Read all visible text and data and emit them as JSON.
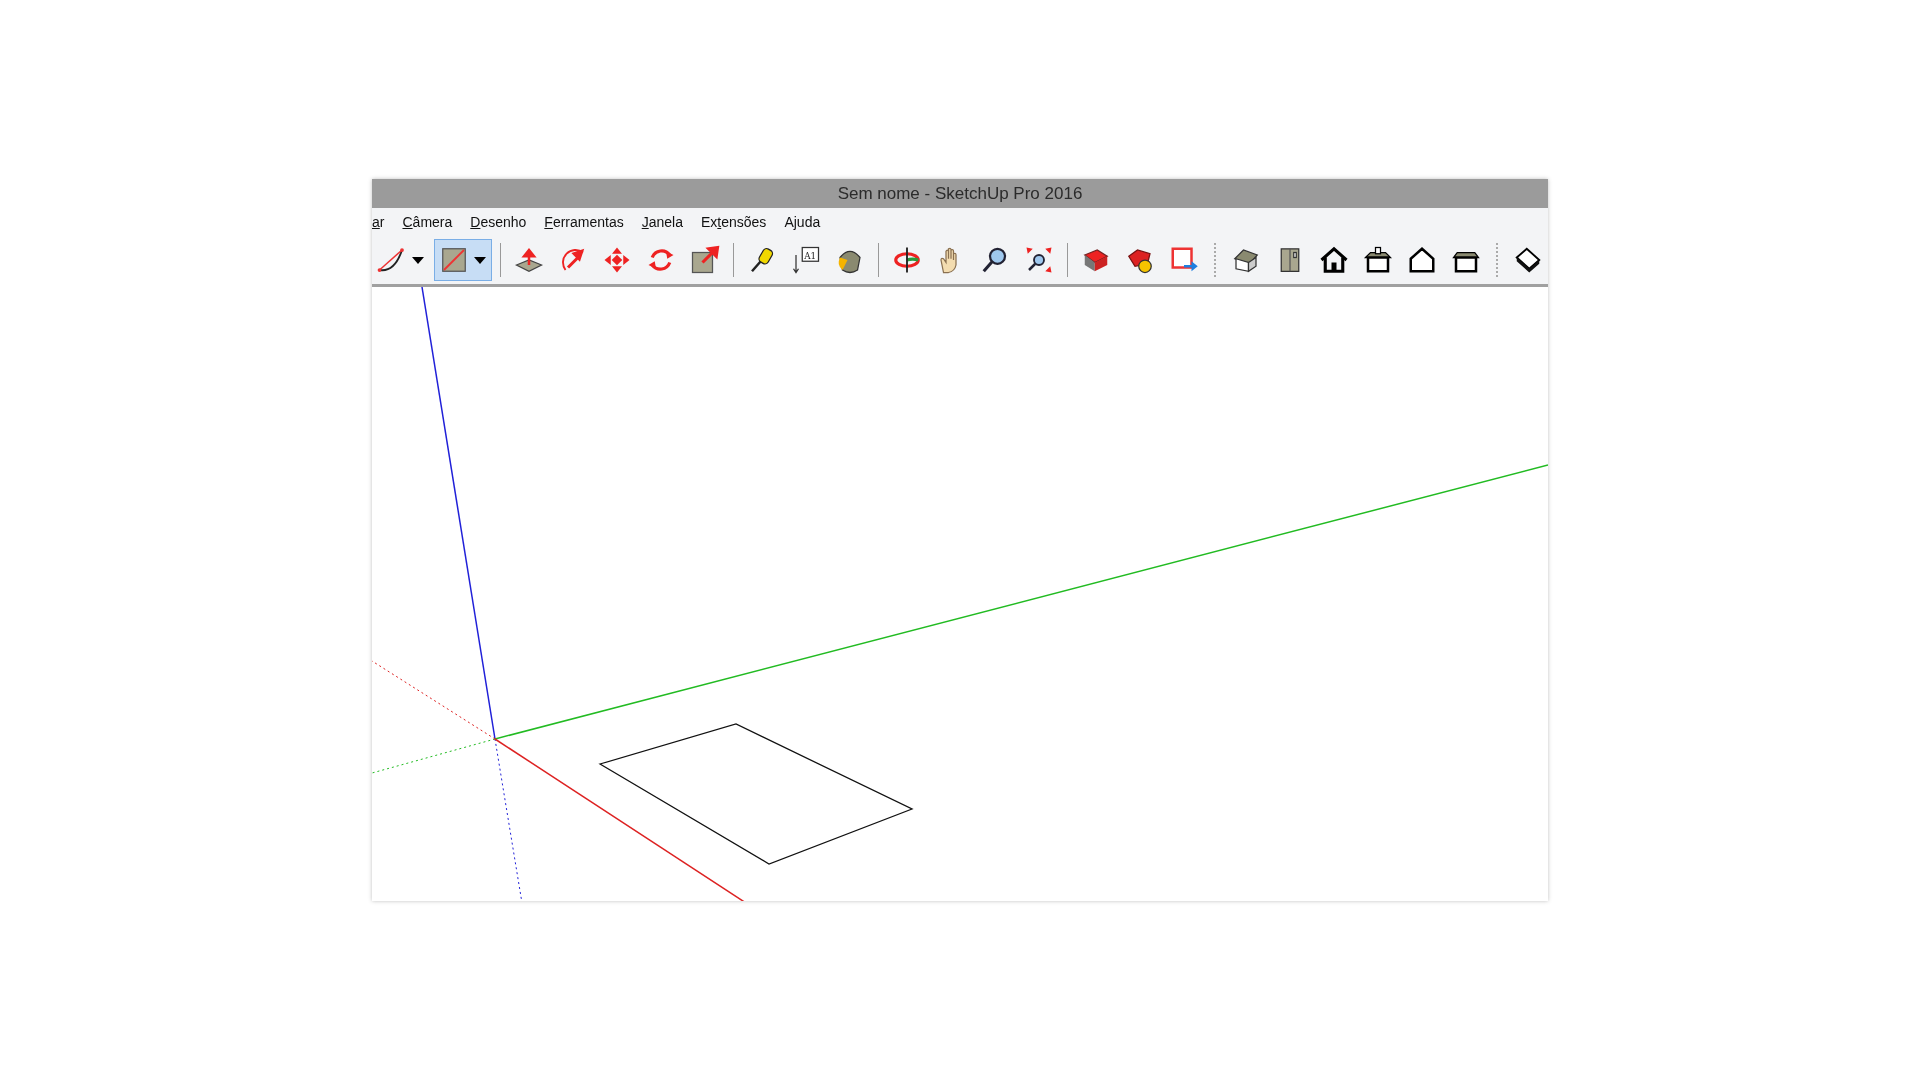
{
  "window": {
    "title": "Sem nome - SketchUp Pro 2016"
  },
  "menu": [
    {
      "key": "a",
      "after": "r"
    },
    {
      "key": "C",
      "after": "âmera"
    },
    {
      "key": "D",
      "after": "esenho"
    },
    {
      "key": "F",
      "after": "erramentas"
    },
    {
      "key": "J",
      "after": "anela"
    },
    {
      "before": "Ex",
      "key": "t",
      "after": "ensões"
    },
    {
      "before": "A",
      "key": "j",
      "after": "uda"
    }
  ],
  "toolbar": [
    {
      "kind": "arc",
      "selected": false,
      "dropdown": true
    },
    {
      "kind": "rectangle",
      "selected": true,
      "dropdown": true
    },
    {
      "kind": "separator"
    },
    {
      "kind": "pushpull",
      "selected": false
    },
    {
      "kind": "followme",
      "selected": false
    },
    {
      "kind": "move",
      "selected": false
    },
    {
      "kind": "rotate",
      "selected": false
    },
    {
      "kind": "scale",
      "selected": false
    },
    {
      "kind": "separator"
    },
    {
      "kind": "tape",
      "selected": false
    },
    {
      "kind": "text",
      "selected": false,
      "label": "A1"
    },
    {
      "kind": "paint",
      "selected": false
    },
    {
      "kind": "separator"
    },
    {
      "kind": "orbit",
      "selected": false
    },
    {
      "kind": "pan",
      "selected": false
    },
    {
      "kind": "zoom",
      "selected": false
    },
    {
      "kind": "zoomextents",
      "selected": false
    },
    {
      "kind": "separator"
    },
    {
      "kind": "warehouse",
      "selected": false
    },
    {
      "kind": "extension",
      "selected": false
    },
    {
      "kind": "share",
      "selected": false
    },
    {
      "kind": "grip"
    },
    {
      "kind": "iso",
      "selected": false
    },
    {
      "kind": "front",
      "selected": false
    },
    {
      "kind": "house",
      "selected": false
    },
    {
      "kind": "top",
      "selected": false
    },
    {
      "kind": "outline",
      "selected": false
    },
    {
      "kind": "side",
      "selected": false
    },
    {
      "kind": "grip"
    },
    {
      "kind": "eraser",
      "selected": false
    }
  ]
}
